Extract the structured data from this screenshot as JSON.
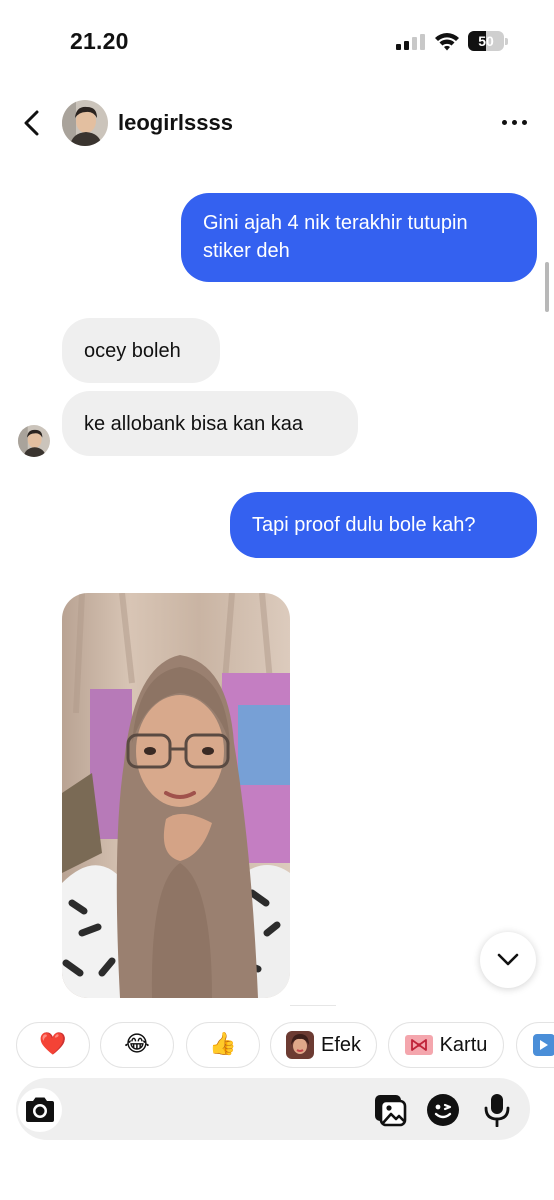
{
  "status_bar": {
    "time": "21.20",
    "battery_level": "50",
    "battery_fraction": 0.5,
    "icons": [
      "signal-icon",
      "wifi-icon",
      "battery-icon"
    ]
  },
  "header": {
    "username": "leogirlssss",
    "icons": [
      "back-arrow-icon",
      "avatar",
      "more-options-icon"
    ]
  },
  "messages": [
    {
      "direction": "outgoing",
      "text": "Gini ajah 4 nik terakhir tutupin stiker deh"
    },
    {
      "direction": "incoming",
      "text": "ocey boleh"
    },
    {
      "direction": "incoming",
      "text": "ke allobank bisa kan kaa"
    },
    {
      "direction": "outgoing",
      "text": "Tapi proof dulu bole kah?"
    },
    {
      "direction": "incoming",
      "type": "photo"
    }
  ],
  "quick_reactions": {
    "heart": "❤️",
    "laugh": "😂",
    "thumbs_up": "👍",
    "efek_label": "Efek",
    "kartu_label": "Kartu"
  },
  "composer": {
    "placeholder": "",
    "icons": [
      "camera-icon",
      "gallery-icon",
      "sticker-icon",
      "microphone-icon"
    ]
  },
  "colors": {
    "outgoing_bubble": "#3461f0",
    "incoming_bubble": "#efefef",
    "background": "#ffffff"
  }
}
